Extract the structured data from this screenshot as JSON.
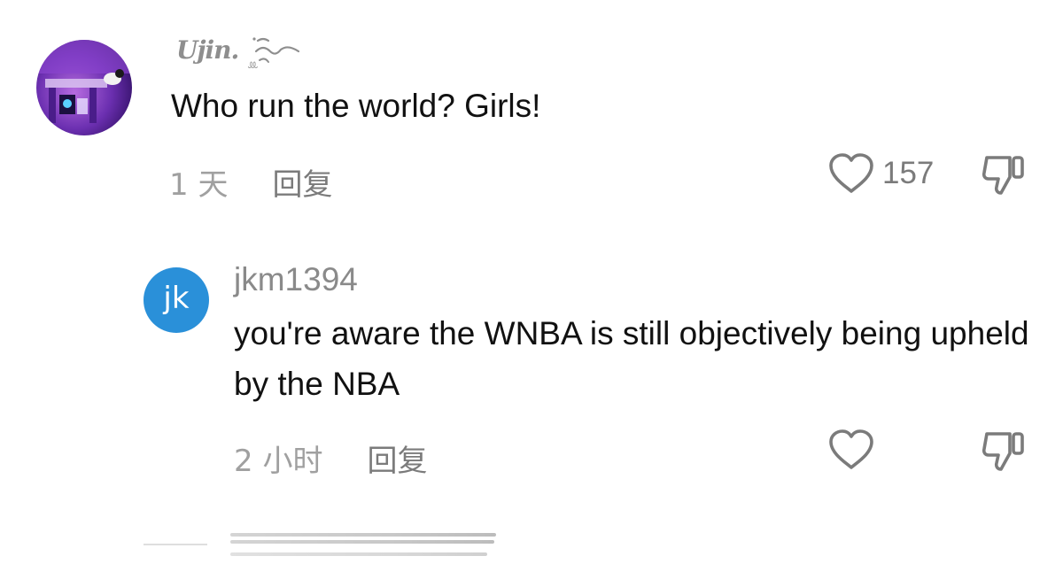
{
  "comments": [
    {
      "username": "Ujin.",
      "text": "Who run the world? Girls!",
      "time": "1 天",
      "reply_label": "回复",
      "likes": "157",
      "avatar_icon": "purple-room-photo-avatar"
    },
    {
      "username": "jkm1394",
      "avatar_initials": "jk",
      "avatar_color": "#2a90d9",
      "text": "you're aware the WNBA is still objectively being upheld by the NBA",
      "time": "2 小时",
      "reply_label": "回复"
    }
  ],
  "colors": {
    "text": "#111111",
    "secondary_text": "#7b7b7b",
    "timestamp": "#a0a0a0",
    "avatar_blue": "#2a90d9"
  },
  "icons": [
    "heart-icon",
    "thumbs-down-icon"
  ]
}
